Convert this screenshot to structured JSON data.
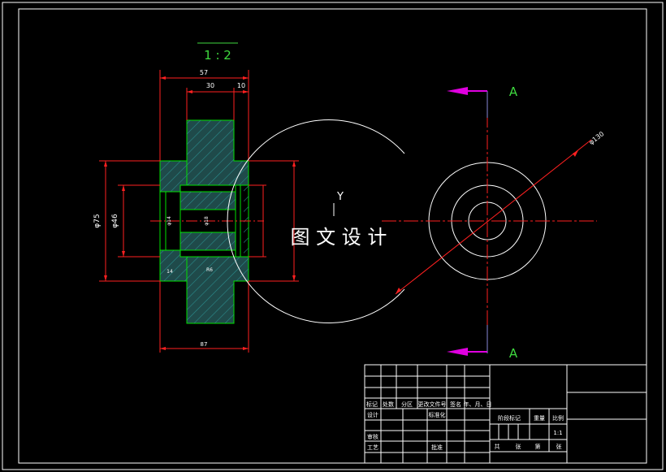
{
  "scale_label": "1 : 2",
  "section_label": "A",
  "axis_label": "Y",
  "watermark": "图 文 设 计",
  "dims": {
    "top_overall": "57",
    "top_mid": "30",
    "top_right": "10",
    "left_outer": "φ75",
    "left_inner": "φ46",
    "bottom_overall": "87",
    "circle_dia": "φ130",
    "small_left": "φ14",
    "small_mid": "φ18",
    "small_bottom": "14",
    "small_bottom_mid": "R6"
  },
  "title_block": {
    "r1": [
      "标记",
      "处数",
      "分区",
      "更改文件号",
      "签名",
      "年、月、日"
    ],
    "design": "设计",
    "standard": "标准化",
    "stage_mark": "阶段标记",
    "weight": "重量",
    "ratio": "比例",
    "ratio_value": "1:1",
    "review": "审核",
    "process": "工艺",
    "approve": "批准",
    "sheets": [
      "共",
      "张",
      "第",
      "张"
    ]
  },
  "colors": {
    "frame": "#ffffff",
    "dim": "#ff2020",
    "part": "#00e000",
    "hatch": "#2a8c8c",
    "arrow": "#e000e0",
    "label": "#3fd93f"
  }
}
